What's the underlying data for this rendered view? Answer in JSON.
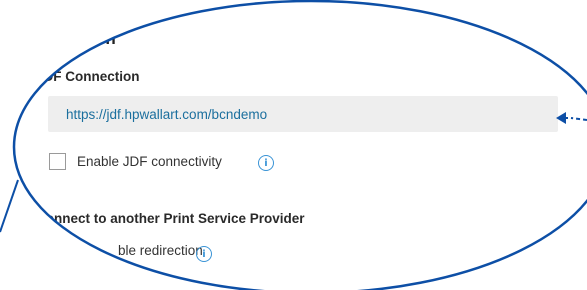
{
  "integration": {
    "section_title": "w Integration",
    "jdf_connection_label": "JDF Connection",
    "jdf_url": "https://jdf.hpwallart.com/bcndemo",
    "enable_jdf_label": "Enable JDF connectivity",
    "enable_jdf_checked": false,
    "psp_heading": "Connect to another Print Service Provider",
    "enable_redirection_label": "ble redirection",
    "info_icon": "info-icon"
  },
  "annotation": {
    "highlight_color": "#0d4fa6",
    "shape": "ellipse-highlight",
    "arrow_icon": "left-arrow-icon"
  }
}
